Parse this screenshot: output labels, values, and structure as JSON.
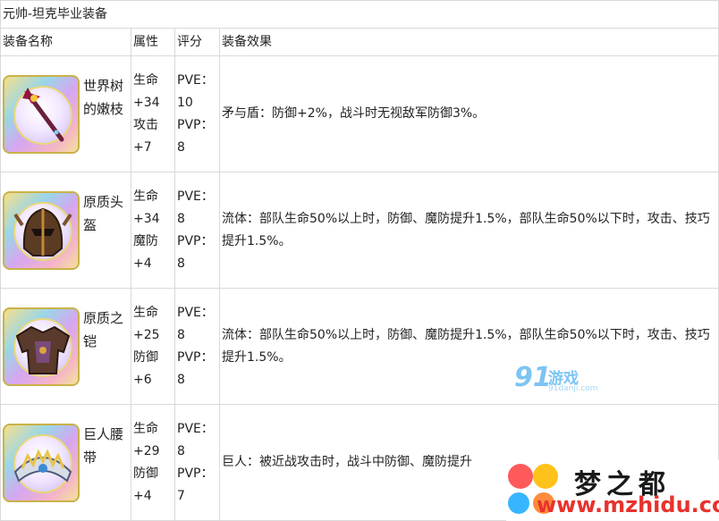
{
  "table": {
    "title": "元帅-坦克毕业装备",
    "headers": {
      "name": "装备名称",
      "attr": "属性",
      "score": "评分",
      "effect": "装备效果"
    },
    "rows": [
      {
        "name": "世界树的嫩枝",
        "icon": "staff-icon",
        "attr1": "生命+34",
        "attr2": "攻击+7",
        "pve": "PVE：10",
        "pvp": "PVP：8",
        "effect": "矛与盾：防御+2%，战斗时无视敌军防御3%。"
      },
      {
        "name": "原质头盔",
        "icon": "helmet-icon",
        "attr1": "生命+34",
        "attr2": "魔防+4",
        "pve": "PVE：8",
        "pvp": "PVP：8",
        "effect": "流体：部队生命50%以上时，防御、魔防提升1.5%，部队生命50%以下时，攻击、技巧提升1.5%。"
      },
      {
        "name": "原质之铠",
        "icon": "armor-icon",
        "attr1": "生命+25",
        "attr2": "防御+6",
        "pve": "PVE：8",
        "pvp": "PVP：8",
        "effect": "流体：部队生命50%以上时，防御、魔防提升1.5%，部队生命50%以下时，攻击、技巧提升1.5%。"
      },
      {
        "name": "巨人腰带",
        "icon": "belt-icon",
        "attr1": "生命+29",
        "attr2": "防御+4",
        "pve": "PVE：8",
        "pvp": "PVP：7",
        "effect": "巨人：被近战攻击时，战斗中防御、魔防提升"
      }
    ]
  },
  "watermarks": {
    "site1_num": "91",
    "site1_name": "游戏",
    "site1_url": "91danji.com",
    "site2_name": "梦之都",
    "site2_url": "www.mzhidu.com"
  }
}
